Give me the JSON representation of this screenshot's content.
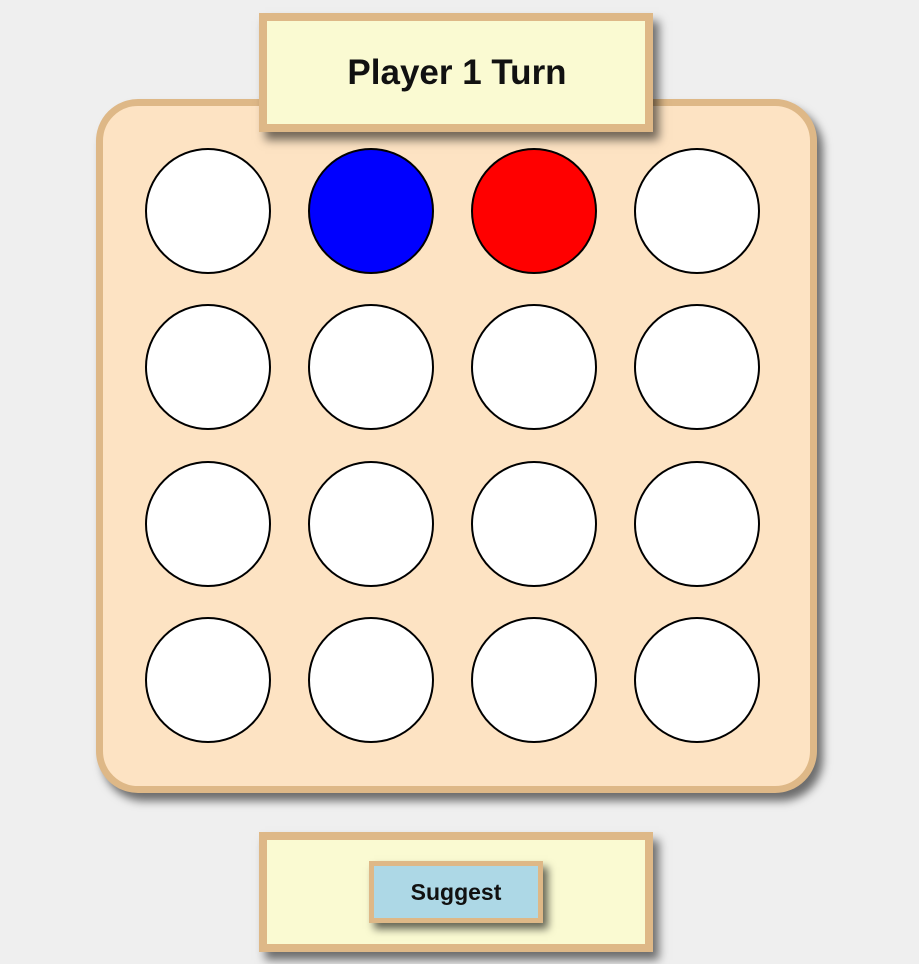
{
  "status": {
    "turn_label": "Player 1 Turn"
  },
  "board": {
    "rows": 4,
    "columns": 4,
    "cells": [
      [
        "empty",
        "blue",
        "red",
        "empty"
      ],
      [
        "empty",
        "empty",
        "empty",
        "empty"
      ],
      [
        "empty",
        "empty",
        "empty",
        "empty"
      ],
      [
        "empty",
        "empty",
        "empty",
        "empty"
      ]
    ],
    "colors": {
      "empty": "#ffffff",
      "blue": "#0000ff",
      "red": "#ff0000"
    }
  },
  "controls": {
    "suggest_label": "Suggest"
  },
  "theme": {
    "background": "#efefef",
    "board_fill": "#fde3c3",
    "frame_border": "#deb887",
    "panel_fill": "#fafad2",
    "button_fill": "#add8e6"
  }
}
